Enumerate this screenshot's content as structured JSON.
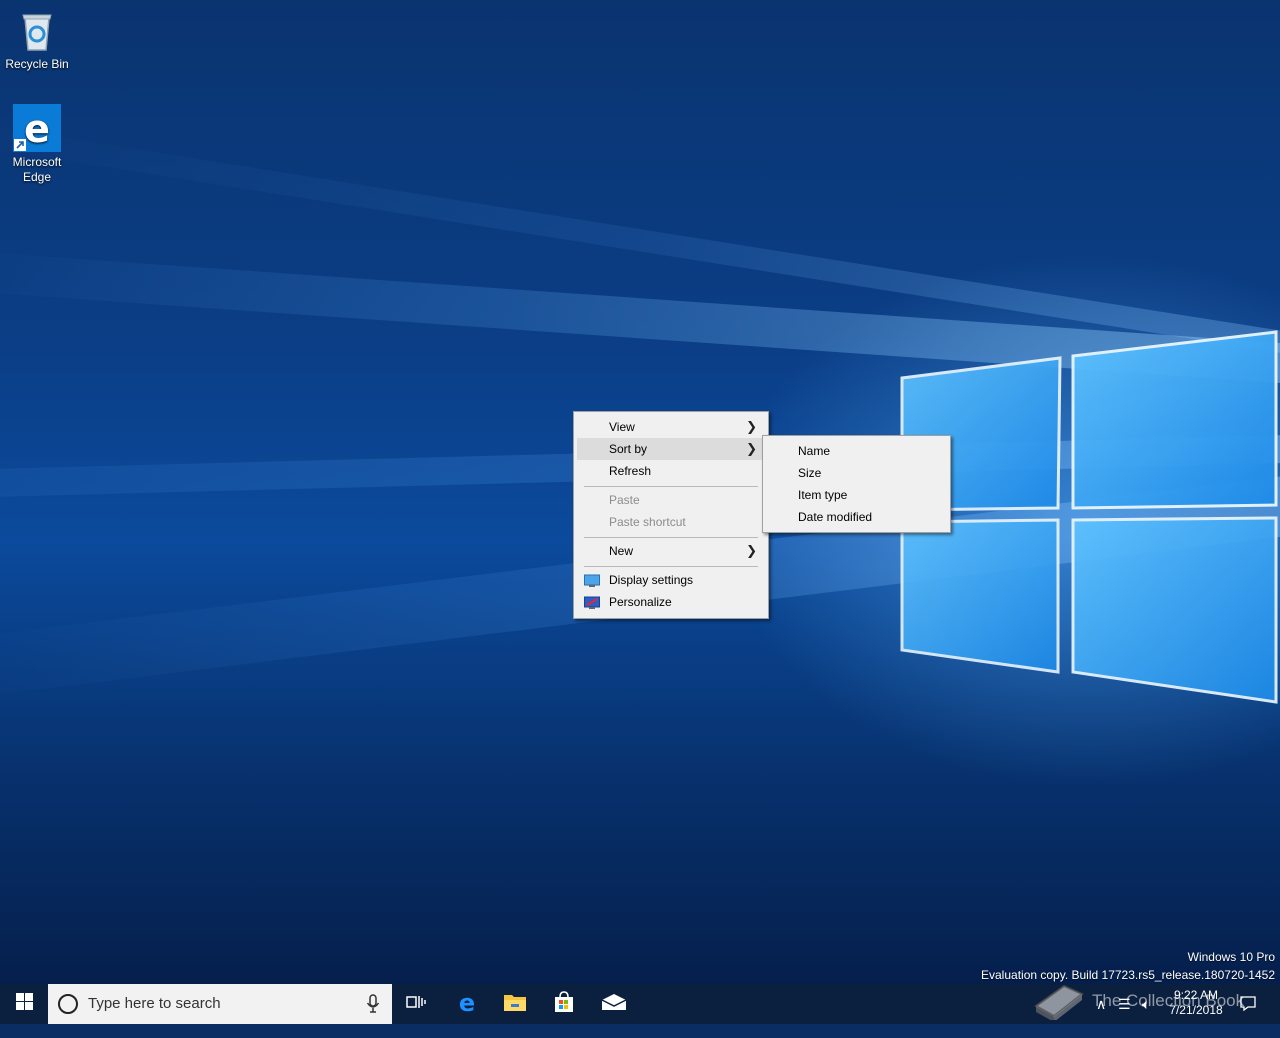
{
  "desktop": {
    "icons": [
      {
        "label": "Recycle Bin",
        "icon": "recycle-bin-icon"
      },
      {
        "label": "Microsoft\nEdge",
        "label_line1": "Microsoft",
        "label_line2": "Edge",
        "icon": "edge-icon"
      }
    ],
    "watermark": {
      "line1": "Windows 10 Pro",
      "line2": "Evaluation copy. Build 17723.rs5_release.180720-1452"
    }
  },
  "context_menu": {
    "items": [
      {
        "label": "View",
        "has_submenu": true,
        "state": "normal"
      },
      {
        "label": "Sort by",
        "has_submenu": true,
        "state": "hover"
      },
      {
        "label": "Refresh",
        "has_submenu": false,
        "state": "normal"
      },
      {
        "label": "Paste",
        "has_submenu": false,
        "state": "disabled"
      },
      {
        "label": "Paste shortcut",
        "has_submenu": false,
        "state": "disabled"
      },
      {
        "label": "New",
        "has_submenu": true,
        "state": "normal"
      },
      {
        "label": "Display settings",
        "icon": "display-settings-icon",
        "state": "normal"
      },
      {
        "label": "Personalize",
        "icon": "personalize-icon",
        "state": "normal"
      }
    ],
    "sort_submenu": [
      {
        "label": "Name"
      },
      {
        "label": "Size"
      },
      {
        "label": "Item type"
      },
      {
        "label": "Date modified"
      }
    ]
  },
  "taskbar": {
    "search_placeholder": "Type here to search",
    "pinned": [
      "task-view-icon",
      "edge-icon",
      "file-explorer-icon",
      "store-icon",
      "mail-icon"
    ],
    "clock": {
      "time": "9:22 AM",
      "date": "7/21/2018"
    },
    "overlay_brand": "The Collection Book"
  },
  "colors": {
    "accent": "#0078d7",
    "taskbar": "#0b1f3e",
    "menu_bg": "#f0f0f0",
    "menu_hover": "#dcdcdc"
  }
}
